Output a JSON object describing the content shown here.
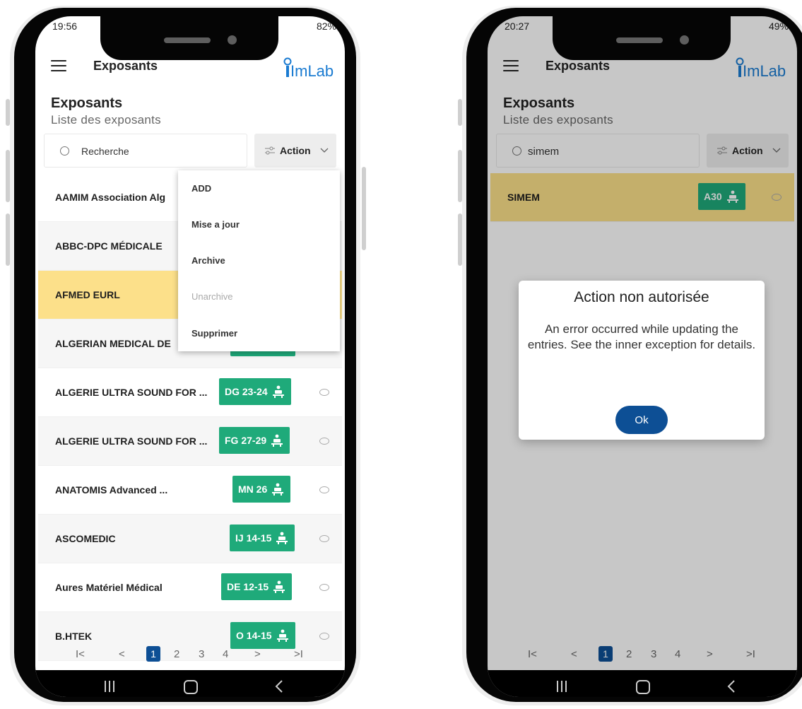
{
  "left_phone": {
    "status": {
      "time": "19:56",
      "battery": "82%"
    },
    "appbar": {
      "title": "Exposants",
      "logo": "ImLab"
    },
    "page": {
      "title": "Exposants",
      "subtitle": "Liste des exposants"
    },
    "search": {
      "value": "Recherche"
    },
    "action": {
      "label": "Action"
    },
    "dropdown": {
      "items": [
        {
          "label": "ADD"
        },
        {
          "label": "Mise a jour"
        },
        {
          "label": "Archive"
        },
        {
          "label": "Unarchive"
        },
        {
          "label": "Supprimer"
        }
      ]
    },
    "rows": [
      {
        "name": "AAMIM Association Alg",
        "badge": ""
      },
      {
        "name": "ABBC-DPC MÉDICALE",
        "badge": ""
      },
      {
        "name": "AFMED EURL",
        "badge": ""
      },
      {
        "name": "ALGERIAN MEDICAL DE",
        "badge": ""
      },
      {
        "name": "ALGERIE ULTRA SOUND FOR ...",
        "badge": "DG 23-24"
      },
      {
        "name": "ALGERIE ULTRA SOUND FOR ...",
        "badge": "FG 27-29"
      },
      {
        "name": "ANATOMIS Advanced ...",
        "badge": "MN 26"
      },
      {
        "name": "ASCOMEDIC",
        "badge": "IJ 14-15"
      },
      {
        "name": "Aures Matériel Médical",
        "badge": "DE 12-15"
      },
      {
        "name": "B.HTEK",
        "badge": "O 14-15"
      }
    ],
    "pager": {
      "first": "I<",
      "prev": "<",
      "pages": [
        "1",
        "2",
        "3",
        "4"
      ],
      "next": ">",
      "last": ">I"
    }
  },
  "right_phone": {
    "status": {
      "time": "20:27",
      "battery": "49%"
    },
    "appbar": {
      "title": "Exposants",
      "logo": "ImLab"
    },
    "page": {
      "title": "Exposants",
      "subtitle": "Liste des exposants"
    },
    "search": {
      "value": "simem"
    },
    "action": {
      "label": "Action"
    },
    "rows": [
      {
        "name": "SIMEM",
        "badge": "A30"
      }
    ],
    "dialog": {
      "title": "Action non autorisée",
      "message": "An error occurred while updating the entries. See the inner exception for details.",
      "ok_label": "Ok"
    },
    "pager": {
      "first": "I<",
      "prev": "<",
      "pages": [
        "1",
        "2",
        "3",
        "4"
      ],
      "next": ">",
      "last": ">I"
    }
  },
  "colors": {
    "badge": "#1faa7a",
    "highlight_row": "#fce08a",
    "primary": "#0d4f95",
    "logo": "#1a7bd1"
  }
}
